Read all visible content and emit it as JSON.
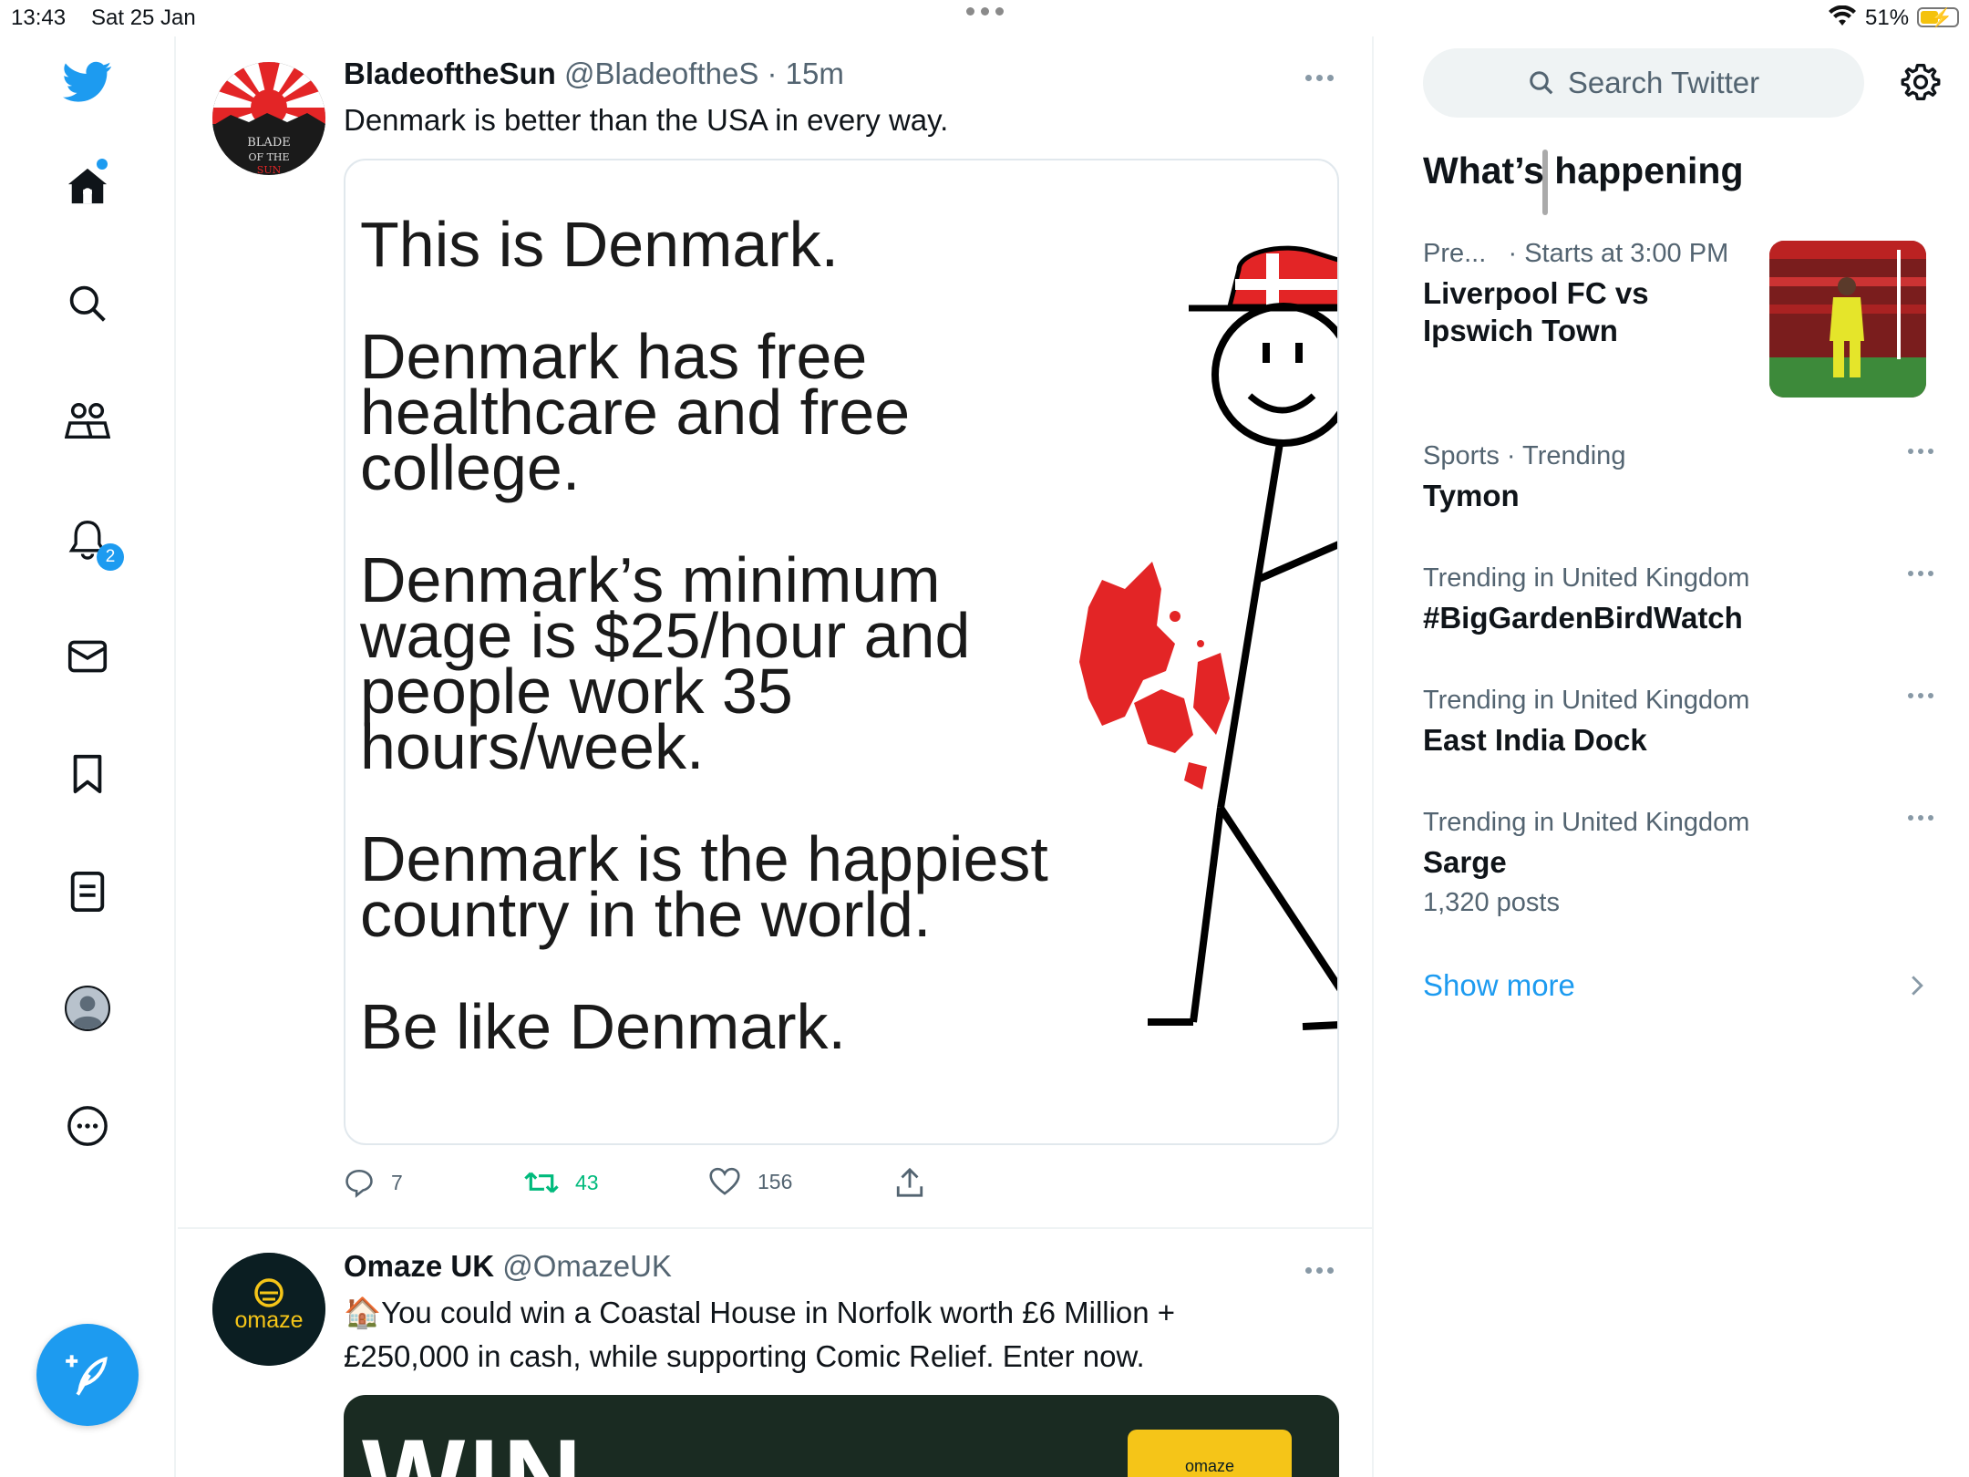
{
  "status_bar": {
    "time": "13:43",
    "date": "Sat 25 Jan",
    "battery_percent": "51%",
    "battery_level": 0.51
  },
  "nav": {
    "items": [
      "home-icon",
      "explore-icon",
      "communities-icon",
      "notifications-icon",
      "messages-icon",
      "bookmarks-icon",
      "lists-icon",
      "profile-icon",
      "more-icon"
    ],
    "notifications_badge": "2"
  },
  "timeline": {
    "tweets": [
      {
        "display_name": "BladeoftheSun",
        "handle": "@BladeoftheS",
        "time": "· 15m",
        "text": "Denmark is better than the USA in every way.",
        "image_text": {
          "line1": "This is Denmark.",
          "p2a": "Denmark has free",
          "p2b": "healthcare and free",
          "p2c": "college.",
          "p3a": "Denmark’s minimum",
          "p3b": "wage is $25/hour and",
          "p3c": "people work 35",
          "p3d": "hours/week.",
          "p4a": "Denmark is the happiest",
          "p4b": "country in the world.",
          "p5": "Be like Denmark."
        },
        "avatar_text": "BLADE OF THE SUN",
        "replies": "7",
        "retweets": "43",
        "likes": "156"
      },
      {
        "display_name": "Omaze UK",
        "handle": "@OmazeUK",
        "emoji": "🏠",
        "text_line1": "You could win a Coastal House in Norfolk worth £6 Million +",
        "text_line2": "£250,000 in cash, while supporting Comic Relief. Enter now.",
        "avatar_text": "omaze",
        "media_text": "WIN",
        "media_badge": "omaze"
      }
    ]
  },
  "sidebar": {
    "search_placeholder": "Search Twitter",
    "section_title": "What’s happening",
    "trends": [
      {
        "context": "Pre...",
        "context2": "· Starts at 3:00 PM",
        "topic_line1": "Liverpool FC vs",
        "topic_line2": "Ipswich Town"
      },
      {
        "context": "Sports · Trending",
        "topic": "Tymon"
      },
      {
        "context": "Trending in United Kingdom",
        "topic": "#BigGardenBirdWatch"
      },
      {
        "context": "Trending in United Kingdom",
        "topic": "East India Dock"
      },
      {
        "context": "Trending in United Kingdom",
        "topic": "Sarge",
        "posts": "1,320 posts"
      }
    ],
    "show_more": "Show more"
  },
  "colors": {
    "accent": "#1d9bf0",
    "retweet_green": "#00ba7c",
    "denmark_red": "#e32526"
  }
}
